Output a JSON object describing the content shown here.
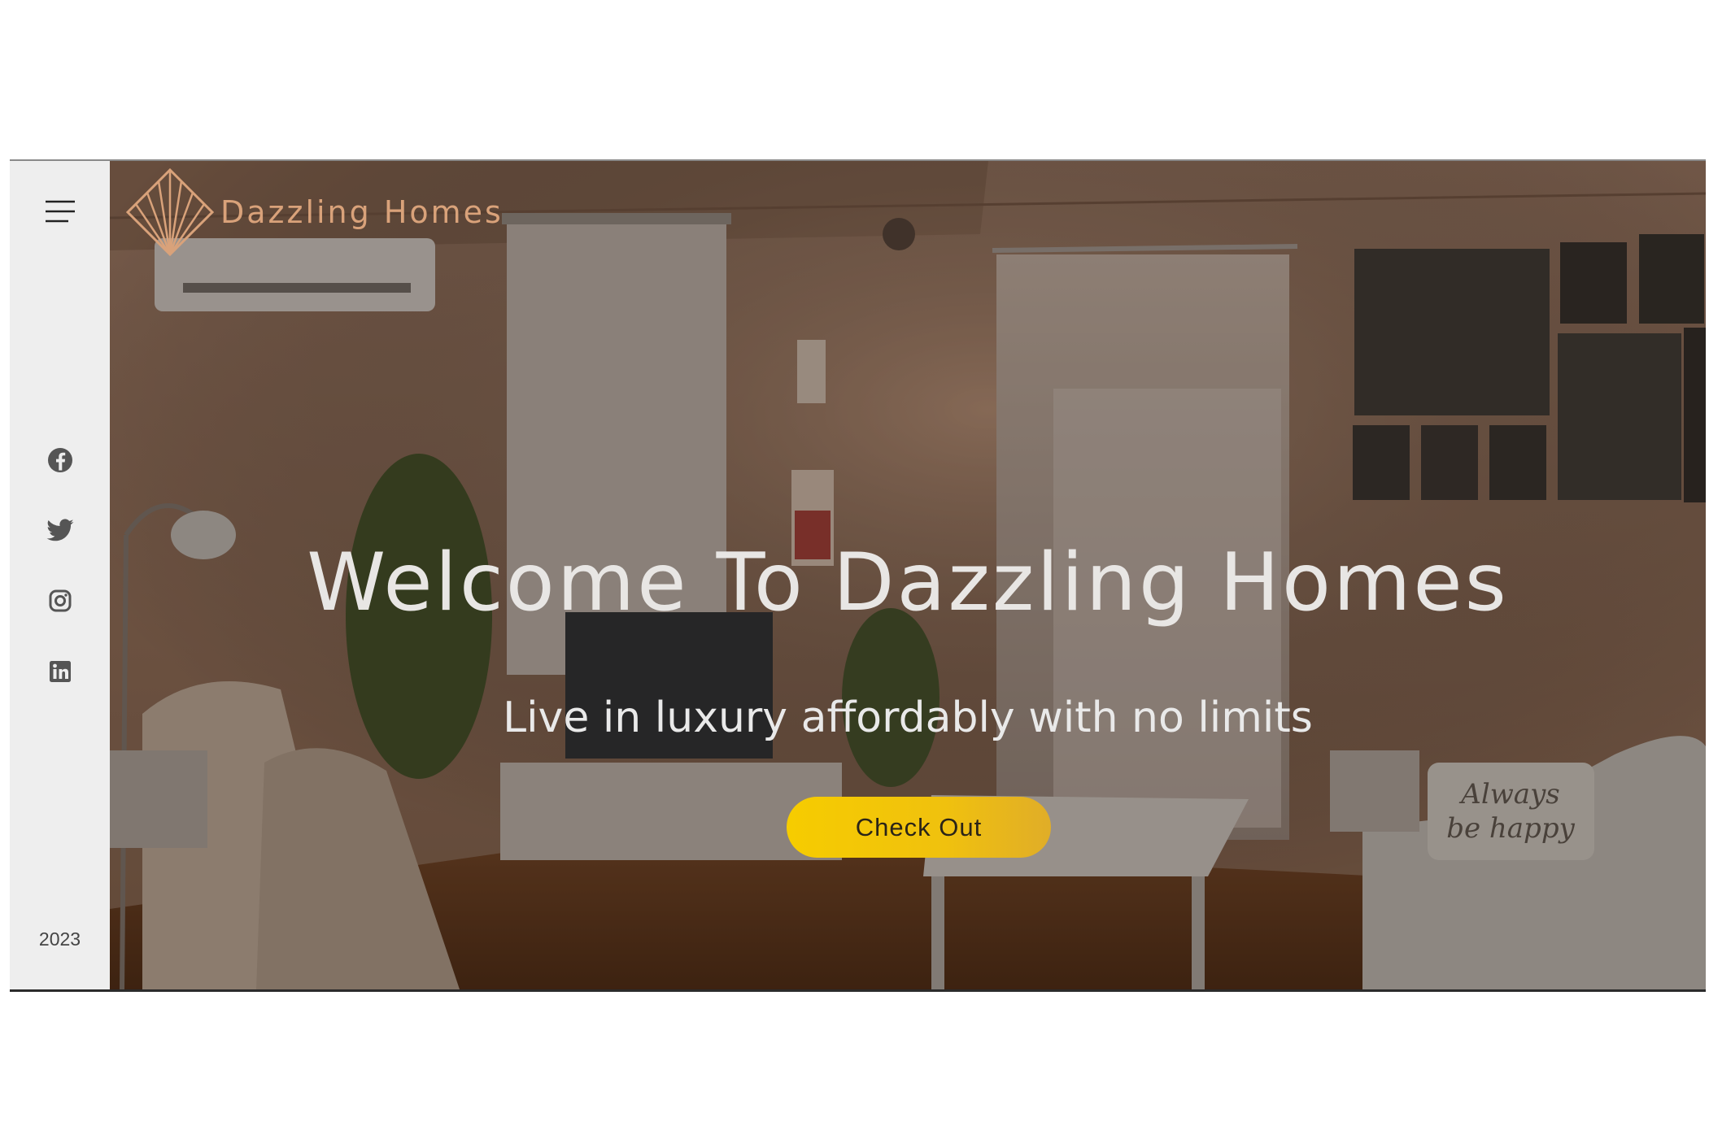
{
  "brand": {
    "name": "Dazzling Homes",
    "color": "#d9a27a"
  },
  "sidebar": {
    "menu_icon": "hamburger-menu-icon",
    "social": [
      {
        "name": "facebook",
        "icon": "facebook-icon"
      },
      {
        "name": "twitter",
        "icon": "twitter-icon"
      },
      {
        "name": "instagram",
        "icon": "instagram-icon"
      },
      {
        "name": "linkedin",
        "icon": "linkedin-icon"
      }
    ],
    "year": "2023"
  },
  "hero": {
    "headline": "Welcome To Dazzling Homes",
    "subheadline": "Live in luxury affordably with no limits",
    "cta_label": "Check Out",
    "cta_color": "#f6cc00",
    "cushion_text": "Always be happy"
  }
}
